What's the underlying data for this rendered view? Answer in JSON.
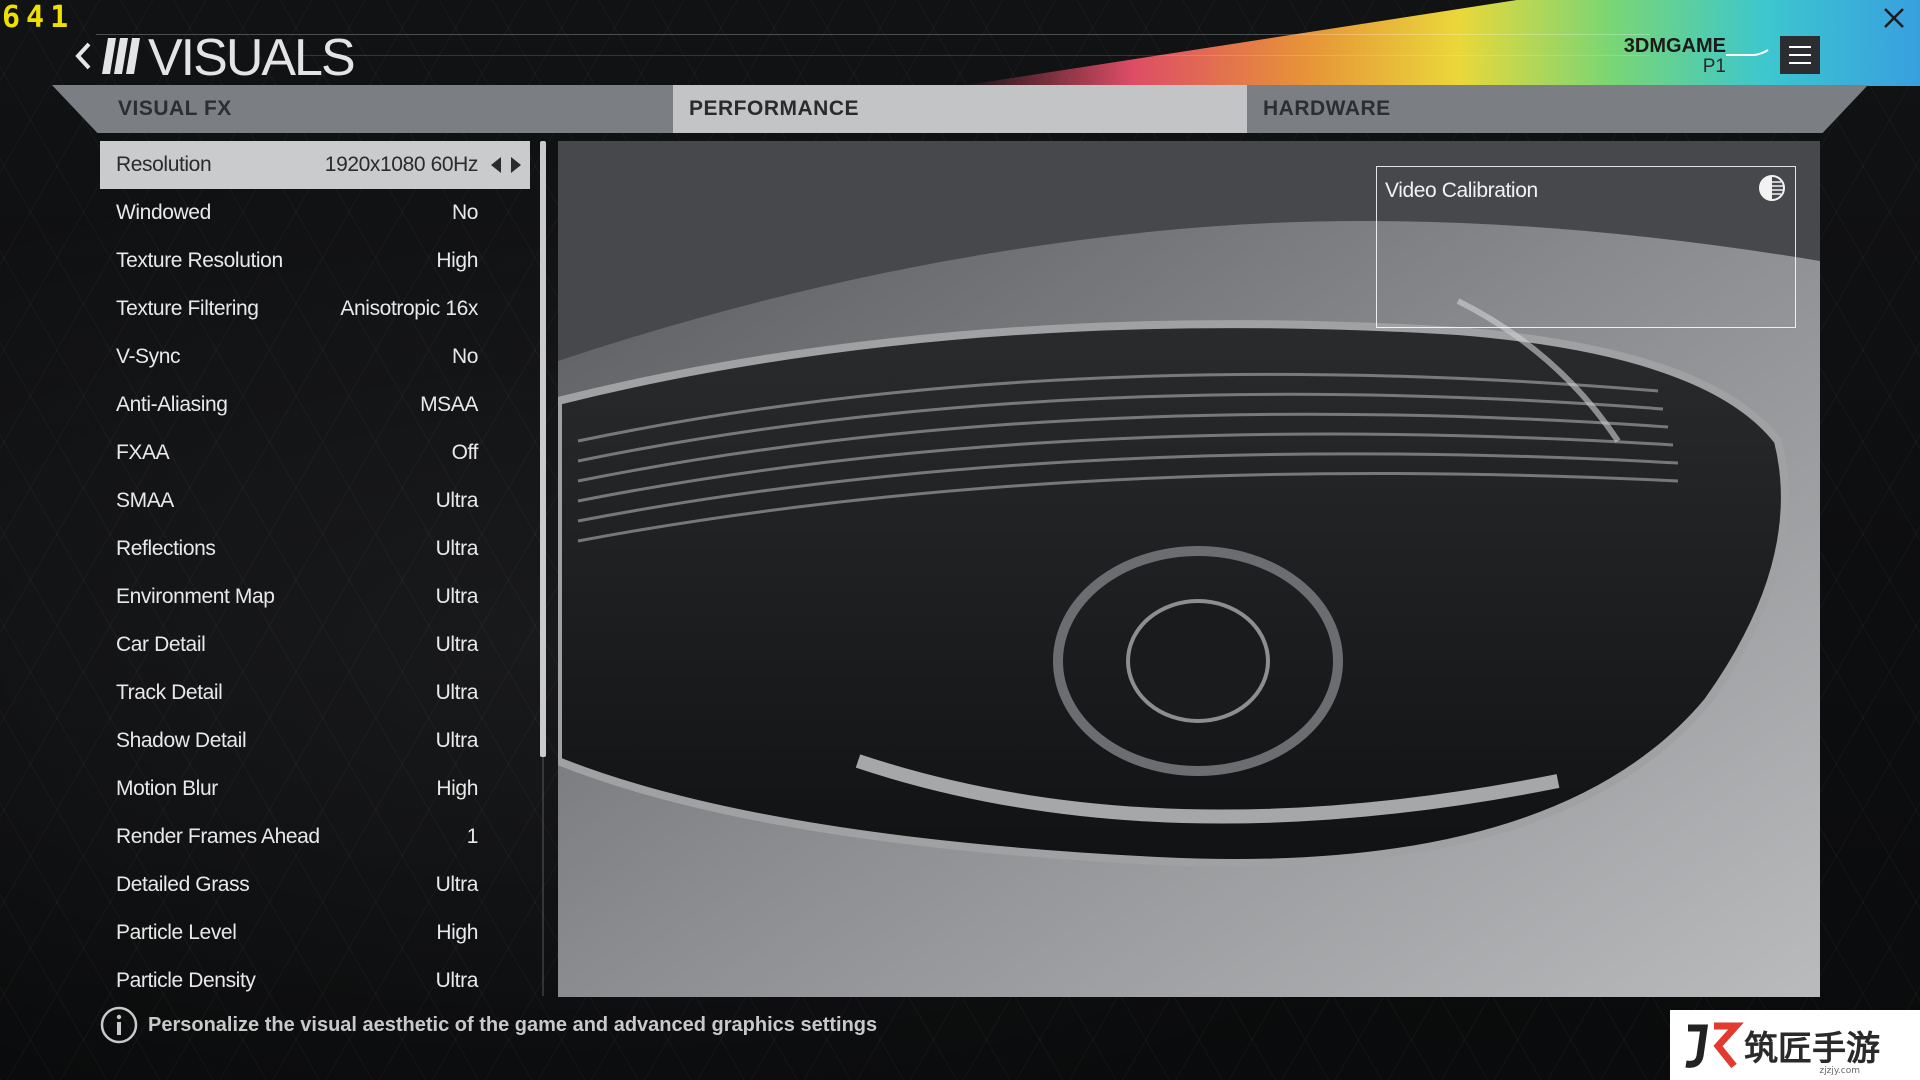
{
  "overlay": {
    "fps": "641"
  },
  "header": {
    "title": "VISUALS",
    "profile_name": "3DMGAME",
    "profile_car": "P1"
  },
  "tabs": [
    {
      "label": "VISUAL FX"
    },
    {
      "label": "PERFORMANCE"
    },
    {
      "label": "HARDWARE"
    }
  ],
  "settings": [
    {
      "label": "Resolution",
      "value": "1920x1080 60Hz"
    },
    {
      "label": "Windowed",
      "value": "No"
    },
    {
      "label": "Texture Resolution",
      "value": "High"
    },
    {
      "label": "Texture Filtering",
      "value": "Anisotropic 16x"
    },
    {
      "label": "V-Sync",
      "value": "No"
    },
    {
      "label": "Anti-Aliasing",
      "value": "MSAA"
    },
    {
      "label": "FXAA",
      "value": "Off"
    },
    {
      "label": "SMAA",
      "value": "Ultra"
    },
    {
      "label": "Reflections",
      "value": "Ultra"
    },
    {
      "label": "Environment Map",
      "value": "Ultra"
    },
    {
      "label": "Car Detail",
      "value": "Ultra"
    },
    {
      "label": "Track Detail",
      "value": "Ultra"
    },
    {
      "label": "Shadow Detail",
      "value": "Ultra"
    },
    {
      "label": "Motion Blur",
      "value": "High"
    },
    {
      "label": "Render Frames Ahead",
      "value": "1"
    },
    {
      "label": "Detailed Grass",
      "value": "Ultra"
    },
    {
      "label": "Particle Level",
      "value": "High"
    },
    {
      "label": "Particle Density",
      "value": "Ultra"
    }
  ],
  "preview": {
    "calibration_label": "Video Calibration"
  },
  "footer": {
    "hint": "Personalize the visual aesthetic of the game and advanced graphics settings"
  },
  "watermark": {
    "text": "筑匠手游",
    "sub": "zjzjy.com"
  },
  "colors": {
    "accent_yellow": "#f0e000",
    "tab_active": "#c2c4c6",
    "tab_bar": "#7b7e82",
    "selected_row": "#c9cbcd"
  }
}
